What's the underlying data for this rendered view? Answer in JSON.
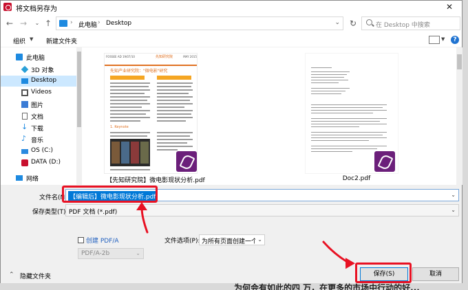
{
  "window": {
    "title": "将文档另存为"
  },
  "address": {
    "segments": [
      "此电脑",
      "Desktop"
    ]
  },
  "search": {
    "placeholder": "在 Desktop 中搜索"
  },
  "toolbar": {
    "organize": "组织",
    "new_folder": "新建文件夹",
    "help": "?"
  },
  "sidebar": {
    "items": [
      {
        "label": "此电脑",
        "icon": "computer-icon",
        "color": "#1e8ae0"
      },
      {
        "label": "3D 对象",
        "icon": "cube-icon",
        "color": "#2aa0d8"
      },
      {
        "label": "Desktop",
        "icon": "desktop-icon",
        "color": "#1e8ae0"
      },
      {
        "label": "Videos",
        "icon": "video-icon",
        "color": "#555555"
      },
      {
        "label": "图片",
        "icon": "picture-icon",
        "color": "#3a7bd5"
      },
      {
        "label": "文档",
        "icon": "document-icon",
        "color": "#6a6a6a"
      },
      {
        "label": "下载",
        "icon": "download-icon",
        "color": "#1e8ae0"
      },
      {
        "label": "音乐",
        "icon": "music-icon",
        "color": "#1e8ae0"
      },
      {
        "label": "OS (C:)",
        "icon": "drive-os-icon",
        "color": "#2a8ae0"
      },
      {
        "label": "DATA (D:)",
        "icon": "drive-data-icon",
        "color": "#c8102e"
      },
      {
        "label": "网络",
        "icon": "network-icon",
        "color": "#1e8ae0"
      }
    ],
    "selected_index": 2
  },
  "files": [
    {
      "name": "【先知研究院】微电影现状分析.pdf",
      "icon": "pdf-file-icon",
      "thumb": {
        "header_left": "FOSSEE AD 19/07/10",
        "header_right": "MAY 2015",
        "title": "先知产业研究院：\"微电影\"研究",
        "brand": "先知研究院",
        "section": "1. Keynote"
      }
    },
    {
      "name": "Doc2.pdf",
      "icon": "pdf-file-icon"
    }
  ],
  "form": {
    "filename_label": "文件名(N):",
    "filename_value": "【编辑后】微电影现状分析.pdf",
    "type_label": "保存类型(T):",
    "type_value": "PDF 文档 (*.pdf)"
  },
  "options": {
    "create_pdfa_label": "创建 PDF/A",
    "pdfa_value": "PDF/A-2b",
    "file_options_label": "文件选项(P):",
    "file_options_value": "为所有页面创建一个文件"
  },
  "footer": {
    "hide_folders": "隐藏文件夹",
    "save": "保存(S)",
    "cancel": "取消"
  },
  "background_text": "为何会有如此的四 万，在更多的市场中行动的好..."
}
